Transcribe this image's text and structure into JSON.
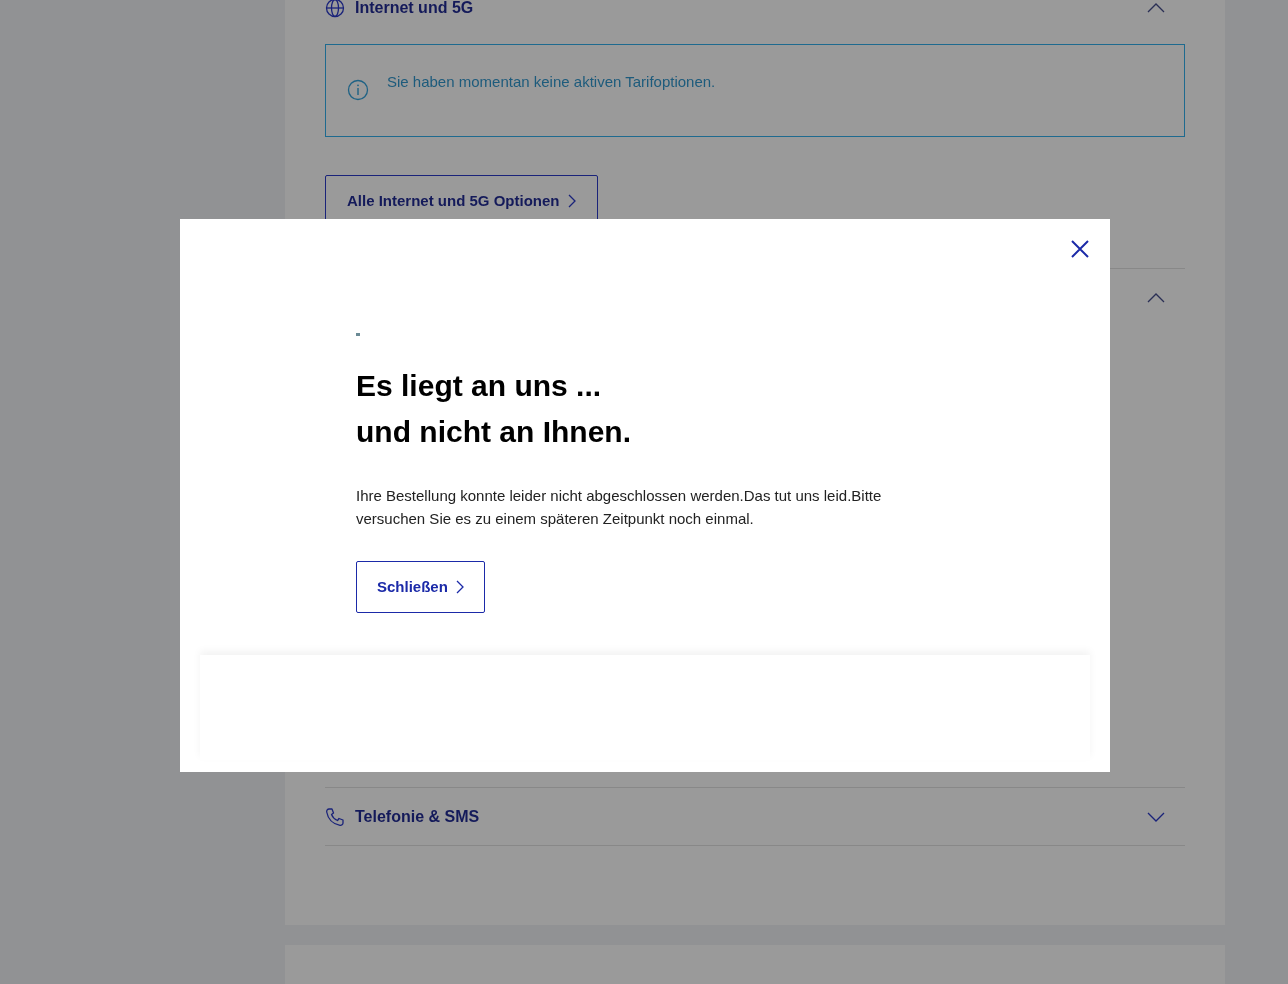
{
  "sections": [
    {
      "kind": "internet",
      "title": "Internet und 5G",
      "expanded": true,
      "info": "Sie haben momentan keine aktiven Tarifoptionen.",
      "button": "Alle Internet und 5G Optionen"
    },
    {
      "kind": "hidden",
      "expanded": true
    },
    {
      "kind": "phone",
      "title": "Telefonie & SMS",
      "expanded": false
    }
  ],
  "dialog": {
    "heading_lines": [
      "Es liegt an uns ...",
      "und nicht an Ihnen."
    ],
    "message": "Ihre Bestellung konnte leider nicht abgeschlossen werden.Das tut uns leid.Bitte versuchen Sie es zu einem späteren Zeitpunkt noch einmal.",
    "button": "Schließen"
  }
}
